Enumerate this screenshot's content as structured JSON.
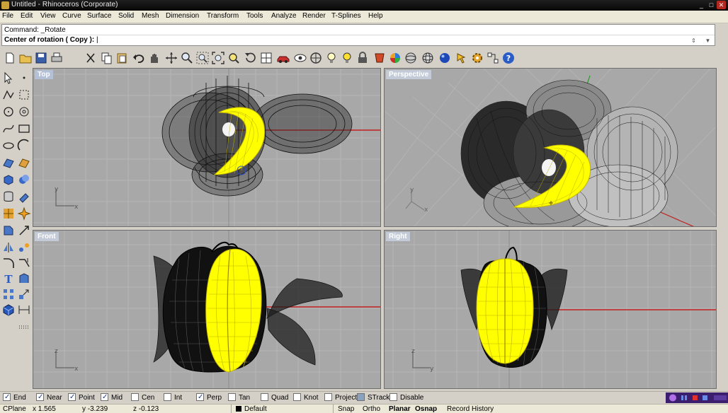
{
  "window": {
    "title": "Untitled - Rhinoceros (Corporate)"
  },
  "menu": [
    "File",
    "Edit",
    "View",
    "Curve",
    "Surface",
    "Solid",
    "Mesh",
    "Dimension",
    "Transform",
    "Tools",
    "Analyze",
    "Render",
    "T-Splines",
    "Help"
  ],
  "command": {
    "history_line": "Command: _Rotate",
    "prompt": "Center of rotation ( Copy ):"
  },
  "viewports": {
    "top": "Top",
    "perspective": "Perspective",
    "front": "Front",
    "right": "Right"
  },
  "axes": {
    "x": "x",
    "y": "y",
    "z": "z"
  },
  "osnap": [
    {
      "label": "End",
      "checked": true
    },
    {
      "label": "Near",
      "checked": true
    },
    {
      "label": "Point",
      "checked": true
    },
    {
      "label": "Mid",
      "checked": true
    },
    {
      "label": "Cen",
      "checked": false
    },
    {
      "label": "Int",
      "checked": false
    },
    {
      "label": "Perp",
      "checked": true
    },
    {
      "label": "Tan",
      "checked": false
    },
    {
      "label": "Quad",
      "checked": false
    },
    {
      "label": "Knot",
      "checked": false
    },
    {
      "label": "Project",
      "checked": false
    },
    {
      "label": "STrack",
      "checked": false
    },
    {
      "label": "Disable",
      "checked": false
    }
  ],
  "status": {
    "cplane": "CPlane",
    "x": "x 1.565",
    "y": "y -3.239",
    "z": "z -0.123",
    "layer": "Default",
    "snap": "Snap",
    "ortho": "Ortho",
    "planar": "Planar",
    "osnap": "Osnap",
    "record_history": "Record History"
  },
  "colors": {
    "background_gray": "#d4d0c8",
    "viewport_gray": "#a8a8a8",
    "selection_yellow": "#ffff00",
    "x_axis_red": "#c02020",
    "viewport_title": "#c3cbd8"
  },
  "icons": {
    "toolbar": [
      "new-icon",
      "open-icon",
      "save-icon",
      "print-icon",
      "cut-icon",
      "copy-icon",
      "paste-icon",
      "undo-icon",
      "pan-hand-icon",
      "rotate-view-icon",
      "zoom-icon",
      "zoom-window-icon",
      "zoom-extents-icon",
      "zoom-selected-icon",
      "undo-view-icon",
      "four-viewports-icon",
      "car-icon",
      "eye-icon",
      "target-icon",
      "lightbulb-icon",
      "lock-icon",
      "material-icon",
      "color-wheel-icon",
      "sphere-icon",
      "render-sphere-icon",
      "arrow-icon",
      "gear-icon",
      "network-icon",
      "help-icon"
    ],
    "left": [
      "select-arrow-icon",
      "point-icon",
      "polyline-icon",
      "rectangle-select-icon",
      "circle-icon",
      "circle-options-icon",
      "curve-icon",
      "rectangle-icon",
      "ellipse-icon",
      "arc-icon",
      "solid-box-icon",
      "surface-icon",
      "mesh-icon",
      "solid-boolean-icon",
      "cylinder-icon",
      "extrude-icon",
      "texture-icon",
      "explode-icon",
      "transform-icon",
      "move-icon",
      "mirror-icon",
      "blend-icon",
      "fillet-icon",
      "rebuild-icon",
      "text-icon",
      "solid-tool-icon",
      "array-icon",
      "scale-icon",
      "cube-icon",
      "dimension-icon",
      "dots-icon"
    ]
  }
}
